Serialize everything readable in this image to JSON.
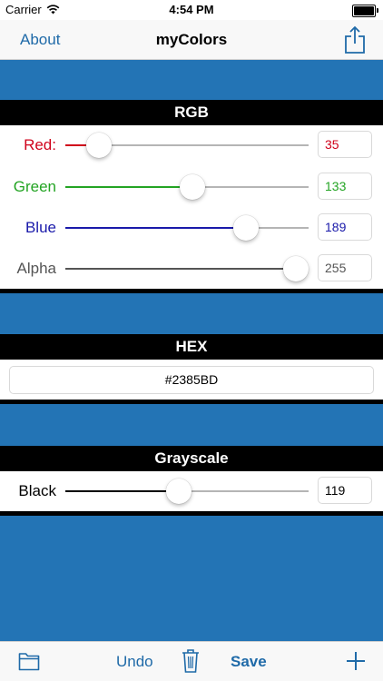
{
  "status_bar": {
    "carrier": "Carrier",
    "time": "4:54 PM",
    "icons": [
      "wifi-icon",
      "battery-icon"
    ]
  },
  "nav": {
    "about_label": "About",
    "title": "myColors",
    "share_icon": "share-icon"
  },
  "color": {
    "preview_hex": "#2374B5",
    "accent_blue": "#1F6AA8"
  },
  "rgb": {
    "header": "RGB",
    "red": {
      "label": "Red:",
      "value": "35",
      "level": 0.137,
      "color": "#D0021B"
    },
    "green": {
      "label": "Green",
      "value": "133",
      "level": 0.522,
      "color": "#23A423"
    },
    "blue": {
      "label": "Blue",
      "value": "189",
      "level": 0.741,
      "color": "#1A1AAA"
    },
    "alpha": {
      "label": "Alpha",
      "value": "255",
      "level": 1.0,
      "color": "#555555"
    }
  },
  "hex": {
    "header": "HEX",
    "value": "#2385BD"
  },
  "grayscale": {
    "header": "Grayscale",
    "black": {
      "label": "Black",
      "value": "119",
      "level": 0.467,
      "color": "#000000"
    }
  },
  "toolbar": {
    "folder_icon": "folder-icon",
    "undo_label": "Undo",
    "trash_icon": "trash-icon",
    "save_label": "Save",
    "add_icon": "plus-icon"
  }
}
